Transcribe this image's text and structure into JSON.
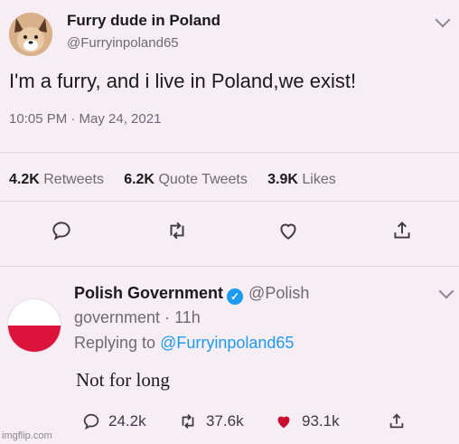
{
  "tweet": {
    "display_name": "Furry dude in Poland",
    "handle": "@Furryinpoland65",
    "text": "I'm a furry, and i live in Poland,we exist!",
    "timestamp": "10:05 PM · May 24, 2021",
    "stats": {
      "retweets_count": "4.2K",
      "retweets_label": "Retweets",
      "quotes_count": "6.2K",
      "quotes_label": "Quote Tweets",
      "likes_count": "3.9K",
      "likes_label": "Likes"
    },
    "actions": [
      "reply-icon",
      "retweet-icon",
      "like-icon",
      "share-icon"
    ]
  },
  "reply": {
    "display_name": "Polish Government",
    "handle_part1": "@Polish",
    "handle_part2": "government",
    "time": "· 11h",
    "replying_prefix": "Replying to",
    "replying_handle": "@Furryinpoland65",
    "text": "Not for long",
    "counts": {
      "replies": "24.2k",
      "retweets": "37.6k",
      "likes": "93.1k"
    },
    "flag_colors": {
      "top": "#ffffff",
      "bottom": "#dc143c"
    },
    "like_color": "#c8102e"
  },
  "watermark": "imgflip.com"
}
